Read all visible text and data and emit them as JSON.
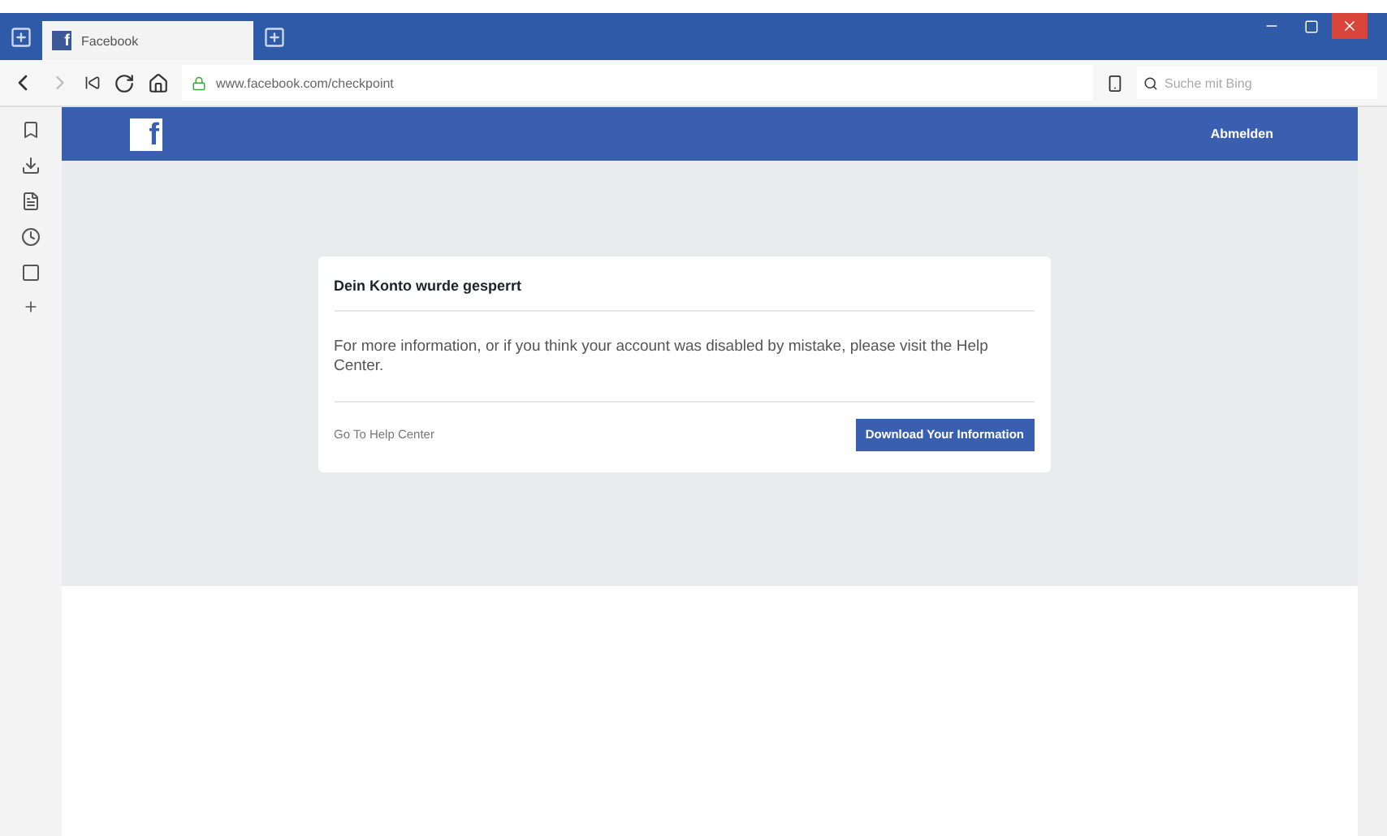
{
  "browser": {
    "tab": {
      "icon_letter": "f",
      "title": "Facebook",
      "selected": true
    },
    "url": "www.facebook.com/checkpoint",
    "search": {
      "placeholder": "Suche mit Bing"
    }
  },
  "header": {
    "logo": "f",
    "logout": "Abmelden"
  },
  "card": {
    "title": "Dein Konto wurde gesperrt",
    "message": "For more information, or if you think your account was disabled by mistake, please visit the Help Center.",
    "help_link": "Go To Help Center",
    "button": "Download Your Information"
  }
}
